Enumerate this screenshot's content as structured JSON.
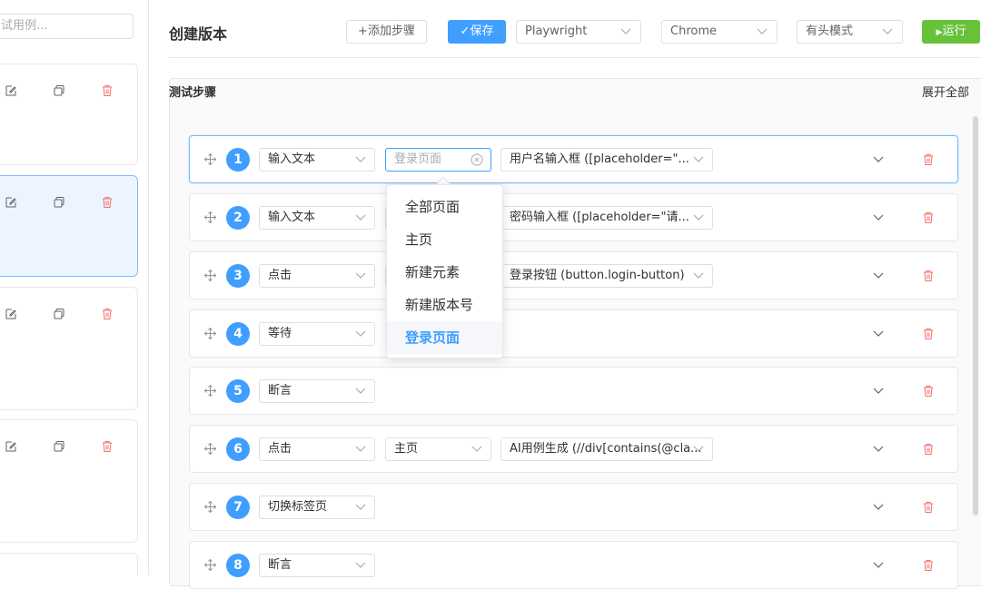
{
  "sidebar": {
    "search_placeholder": "试用例..."
  },
  "header": {
    "title": "创建版本",
    "add_step_label": "+添加步骤",
    "save_label": "保存",
    "run_label": "运行",
    "engine_select": "Playwright",
    "browser_select": "Chrome",
    "mode_select": "有头模式"
  },
  "steps_panel": {
    "title": "测试步骤",
    "expand_all": "展开全部"
  },
  "steps": [
    {
      "number": "1",
      "action": "输入文本",
      "page_placeholder": "登录页面",
      "element": "用户名输入框 ([placeholder=\"..."
    },
    {
      "number": "2",
      "action": "输入文本",
      "page": "",
      "element": "密码输入框 ([placeholder=\"请..."
    },
    {
      "number": "3",
      "action": "点击",
      "page": "",
      "element": "登录按钮 (button.login-button)"
    },
    {
      "number": "4",
      "action": "等待"
    },
    {
      "number": "5",
      "action": "断言"
    },
    {
      "number": "6",
      "action": "点击",
      "page": "主页",
      "element": "AI用例生成 (//div[contains(@cla..."
    },
    {
      "number": "7",
      "action": "切换标签页"
    },
    {
      "number": "8",
      "action": "断言"
    }
  ],
  "page_dropdown": {
    "options": [
      "全部页面",
      "主页",
      "新建元素",
      "新建版本号",
      "登录页面"
    ],
    "selected": "登录页面"
  },
  "colors": {
    "primary": "#409eff",
    "success": "#67c23a",
    "danger": "#f56c6c"
  }
}
